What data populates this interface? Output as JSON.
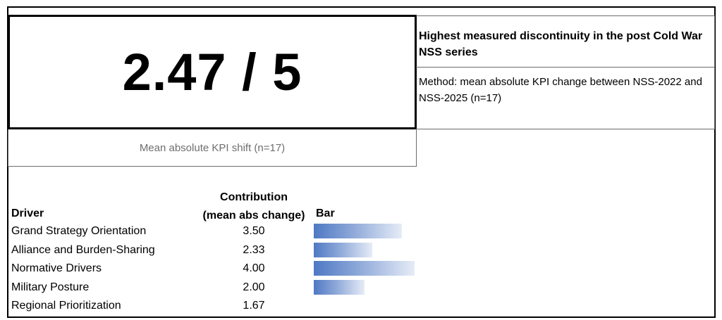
{
  "score": {
    "value": "2.47 / 5",
    "subtitle": "Mean absolute KPI shift (n=17)"
  },
  "headline": {
    "text": "Highest measured discontinuity in the post Cold War NSS series"
  },
  "method": {
    "text": "Method: mean absolute KPI change between NSS-2022 and NSS-2025 (n=17)"
  },
  "table": {
    "header_driver": "Driver",
    "header_contribution_line1": "Contribution",
    "header_contribution_line2": "(mean abs change)",
    "header_bar": "Bar",
    "bar_max": 4.0,
    "bar_color_start": "#4f79c4",
    "bar_color_end": "#e6ecf7",
    "rows": [
      {
        "driver": "Grand Strategy Orientation",
        "value": "3.50",
        "num": 3.5,
        "bar": true
      },
      {
        "driver": "Alliance and Burden-Sharing",
        "value": "2.33",
        "num": 2.33,
        "bar": true
      },
      {
        "driver": "Normative Drivers",
        "value": "4.00",
        "num": 4.0,
        "bar": true
      },
      {
        "driver": "Military Posture",
        "value": "2.00",
        "num": 2.0,
        "bar": true
      },
      {
        "driver": "Regional Prioritization",
        "value": "1.67",
        "num": 1.67,
        "bar": false
      }
    ]
  }
}
